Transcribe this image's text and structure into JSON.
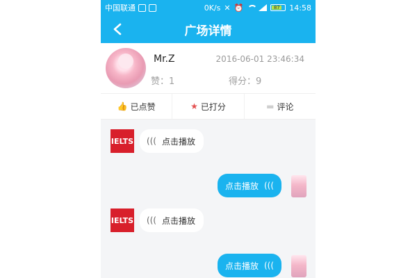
{
  "status_bar": {
    "carrier": "中国联通",
    "speed": "0K/s",
    "battery": "87",
    "time": "14:58"
  },
  "header": {
    "title": "广场详情"
  },
  "post": {
    "username": "Mr.Z",
    "timestamp": "2016-06-01 23:46:34",
    "likes": "赞：1",
    "score": "得分：9"
  },
  "actions": {
    "liked_label": "已点赞",
    "rated_label": "已打分",
    "comment_label": "评论"
  },
  "messages": [
    {
      "sender": "IELTS",
      "side": "left",
      "label": "点击播放"
    },
    {
      "sender": "user",
      "side": "right",
      "label": "点击播放"
    },
    {
      "sender": "IELTS",
      "side": "left",
      "label": "点击播放"
    },
    {
      "sender": "user",
      "side": "right",
      "label": "点击播放"
    }
  ],
  "colors": {
    "accent": "#1ab3ef",
    "ielts_red": "#d81f2b",
    "action_red": "#e34f4f"
  },
  "icons": {
    "back": "chevron-left-icon",
    "liked": "thumbs-up-icon",
    "rated": "star-icon",
    "comment": "comment-icon",
    "audio": "audio-wave-icon"
  }
}
